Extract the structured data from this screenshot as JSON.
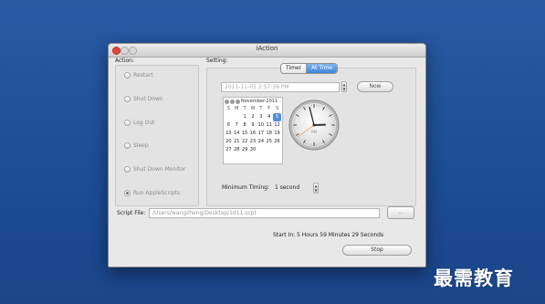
{
  "window": {
    "title": "iAction"
  },
  "action": {
    "heading": "Action:",
    "options": [
      "Restart",
      "Shut Down",
      "Log Out",
      "Sleep",
      "Shut Down Monitor",
      "Run AppleScripts"
    ],
    "selected": "Run AppleScripts"
  },
  "setting": {
    "heading": "Setting:",
    "tabs": [
      "Timer",
      "At Time"
    ],
    "active_tab": "At Time",
    "datetime": "2011-11-05  2:57:39 PM",
    "now_label": "Now",
    "calendar": {
      "month": "November-2011",
      "weekdays": [
        "S",
        "M",
        "T",
        "W",
        "T",
        "F",
        "S"
      ],
      "selected_day": "5"
    },
    "clock": {
      "am_pm": "PM",
      "hour": 2,
      "minute": 57,
      "second": 39
    },
    "min_timing_label": "Minimum Timing:",
    "min_timing_value": "1 second"
  },
  "script": {
    "label": "Script File:",
    "path": "/Users/wangzheng/Desktop/1d11.scpt",
    "browse_label": "..."
  },
  "status": {
    "start_in": "Start In:  5 Hours 59 Minutes 29 Seconds"
  },
  "stop_label": "Stop",
  "watermark": "最需教育",
  "colors": {
    "desktop": "#1e4e96",
    "accent": "#4f8fd9",
    "close": "#e0443e"
  }
}
